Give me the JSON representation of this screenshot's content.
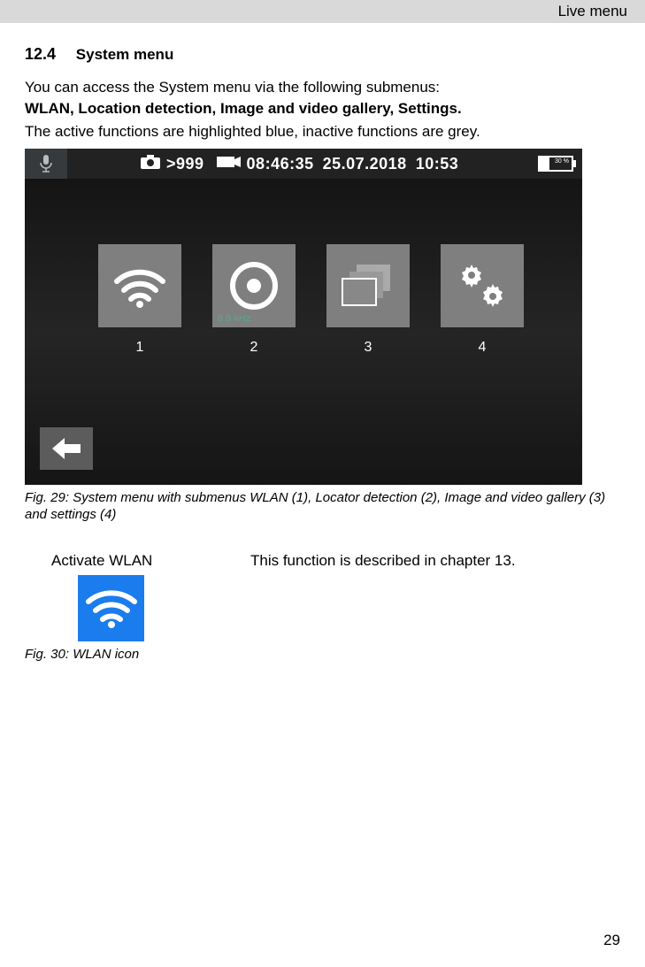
{
  "header": {
    "title": "Live menu"
  },
  "section": {
    "number": "12.4",
    "title": "System menu"
  },
  "paragraphs": {
    "p1": "You can access the System menu via the following submenus:",
    "p2": "WLAN, Location detection, Image and video gallery, Settings.",
    "p3": "The active functions are highlighted blue, inactive functions are grey."
  },
  "statusbar": {
    "photo_count": ">999",
    "video_time": "08:46:35",
    "date": "25.07.2018",
    "time": "10:53",
    "battery_pct": "30 %"
  },
  "tiles": {
    "wlan_num": "1",
    "locator_num": "2",
    "locator_sub": "8.9 kHz",
    "gallery_num": "3",
    "settings_num": "4"
  },
  "fig29_caption": "Fig. 29: System menu with submenus WLAN (1), Locator detection (2), Image and video gallery (3) and settings (4)",
  "activate_wlan": {
    "label": "Activate WLAN",
    "description": "This function is described in chapter 13.",
    "caption": "Fig. 30: WLAN icon"
  },
  "page_number": "29"
}
